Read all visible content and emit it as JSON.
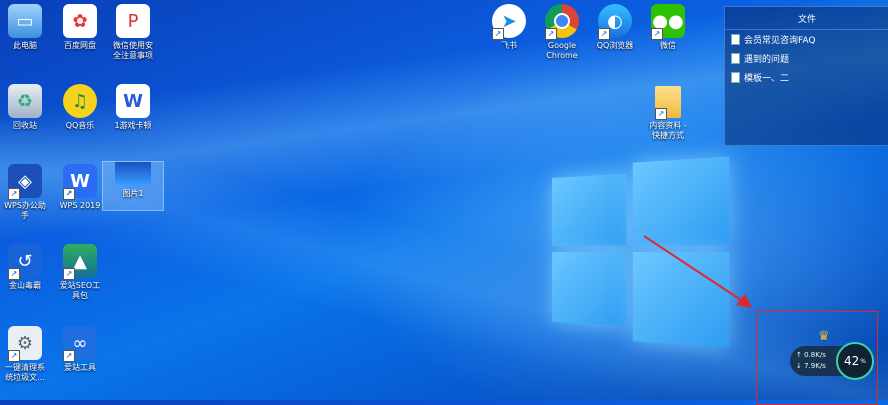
{
  "desktop_icons": {
    "pc": "此电脑",
    "netdisk": "百度网盘",
    "wechat_guide": "微信使用安\n全注意事项",
    "recycle": "回收站",
    "qqmusic": "QQ音乐",
    "doc1": "1游戏卡顿",
    "wps_helper": "WPS办公助\n手",
    "wps2019": "WPS 2019",
    "screenshot": "图片1",
    "jinshan": "金山毒霸",
    "seo": "爱站SEO工\n具包",
    "cleaner": "一键清理系\n统垃圾文...",
    "aizhan": "爱站工具",
    "feishu": "飞书",
    "chrome": "Google\nChrome",
    "qqbrowser": "QQ浏览器",
    "weixin": "微信",
    "folder": "内容资料 -\n快捷方式"
  },
  "files_panel": {
    "title": "文件",
    "items": [
      "会员常见咨询FAQ",
      "遇到的问题",
      "模板一、二"
    ]
  },
  "network_widget": {
    "upload": "0.8K/s",
    "download": "7.9K/s",
    "percent": "42",
    "percent_unit": "%"
  },
  "colors": {
    "highlight": "#e0282c",
    "gauge_ring": "#3cd4a8"
  }
}
